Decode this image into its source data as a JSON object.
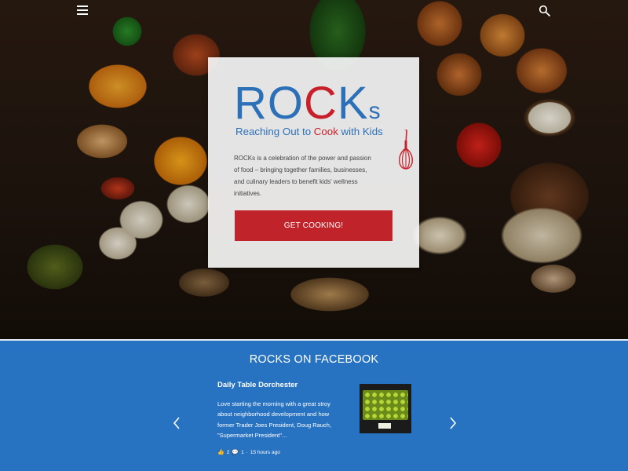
{
  "header": {
    "menu_icon": "hamburger-menu-icon",
    "search_icon": "search-icon"
  },
  "hero": {
    "logo": {
      "wordmark_blue": "RO",
      "wordmark_red": "C",
      "wordmark_blue2": "K",
      "wordmark_small": "s",
      "tagline_part1": "Reaching Out to ",
      "tagline_red": "Cook",
      "tagline_part2": " with Kids"
    },
    "description": "ROCKs is a celebration of the power and passion of food – bringing together families, businesses, and culinary leaders to benefit kids' wellness initiatives.",
    "cta_label": "GET COOKING!"
  },
  "facebook": {
    "section_title": "ROCKS ON FACEBOOK",
    "post": {
      "author": "Daily Table Dorchester",
      "body": "Love starting the morning with a great stroy about neighborhood development and how former Trader Joes President, Doug Rauch, \"Supermarket President\"...",
      "likes": "2",
      "comments": "1",
      "time": "15 hours ago"
    }
  },
  "colors": {
    "brand_blue": "#2c71b8",
    "brand_red": "#c0242a",
    "section_blue": "#2873c1"
  }
}
